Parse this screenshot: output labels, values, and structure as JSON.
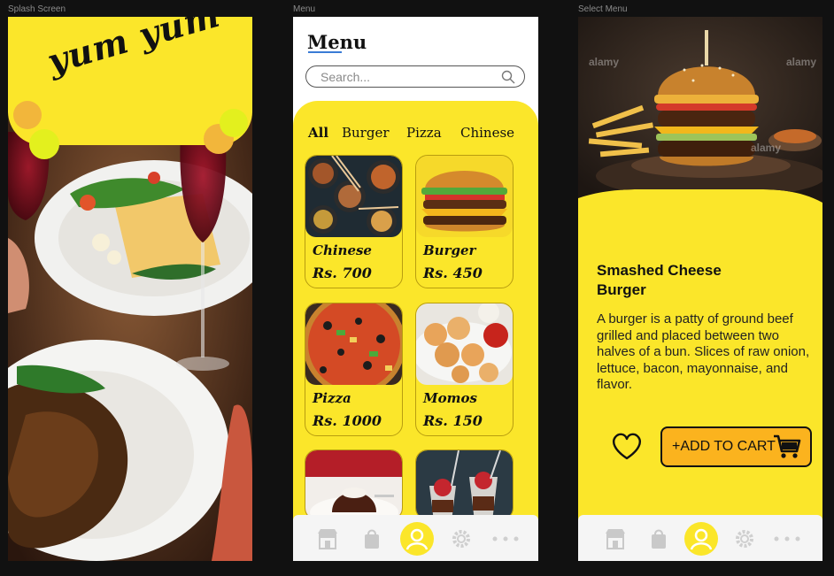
{
  "frames": {
    "splash_label": "Splash Screen",
    "menu_label": "Menu",
    "select_label": "Select Menu"
  },
  "splash": {
    "logo_text": "yum yum",
    "colors": {
      "banner": "#fbe62a",
      "dot_orange": "#f2b63b",
      "dot_lime": "#e3f01e"
    }
  },
  "menu": {
    "title": "Menu",
    "search": {
      "placeholder": "Search...",
      "value": ""
    },
    "tabs": [
      "All",
      "Burger",
      "Pizza",
      "Chinese"
    ],
    "active_tab": "All",
    "items": [
      {
        "name": "Chinese",
        "price": "Rs. 700",
        "image": "chinese-food-image"
      },
      {
        "name": "Burger",
        "price": "Rs. 450",
        "image": "burger-image"
      },
      {
        "name": "Pizza",
        "price": "Rs. 1000",
        "image": "pizza-image"
      },
      {
        "name": "Momos",
        "price": "Rs. 150",
        "image": "momos-image"
      },
      {
        "name": "",
        "price": "",
        "image": "lava-cake-image"
      },
      {
        "name": "",
        "price": "",
        "image": "dessert-cups-image"
      }
    ],
    "nav": [
      "store-icon",
      "shopping-bag-icon",
      "profile-icon",
      "gear-icon",
      "more-icon"
    ],
    "colors": {
      "accent": "#fbe62a",
      "nav_bg": "#f5f5f5"
    }
  },
  "detail": {
    "title": "Smashed Cheese Burger",
    "description": "A burger is a patty of ground beef grilled and placed between two halves of a bun. Slices of raw onion, lettuce, bacon, mayonnaise, and flavor.",
    "add_to_cart_label": "+ADD TO CART",
    "watermark": "alamy",
    "colors": {
      "accent": "#fbe62a",
      "button": "#fbb31e"
    }
  }
}
